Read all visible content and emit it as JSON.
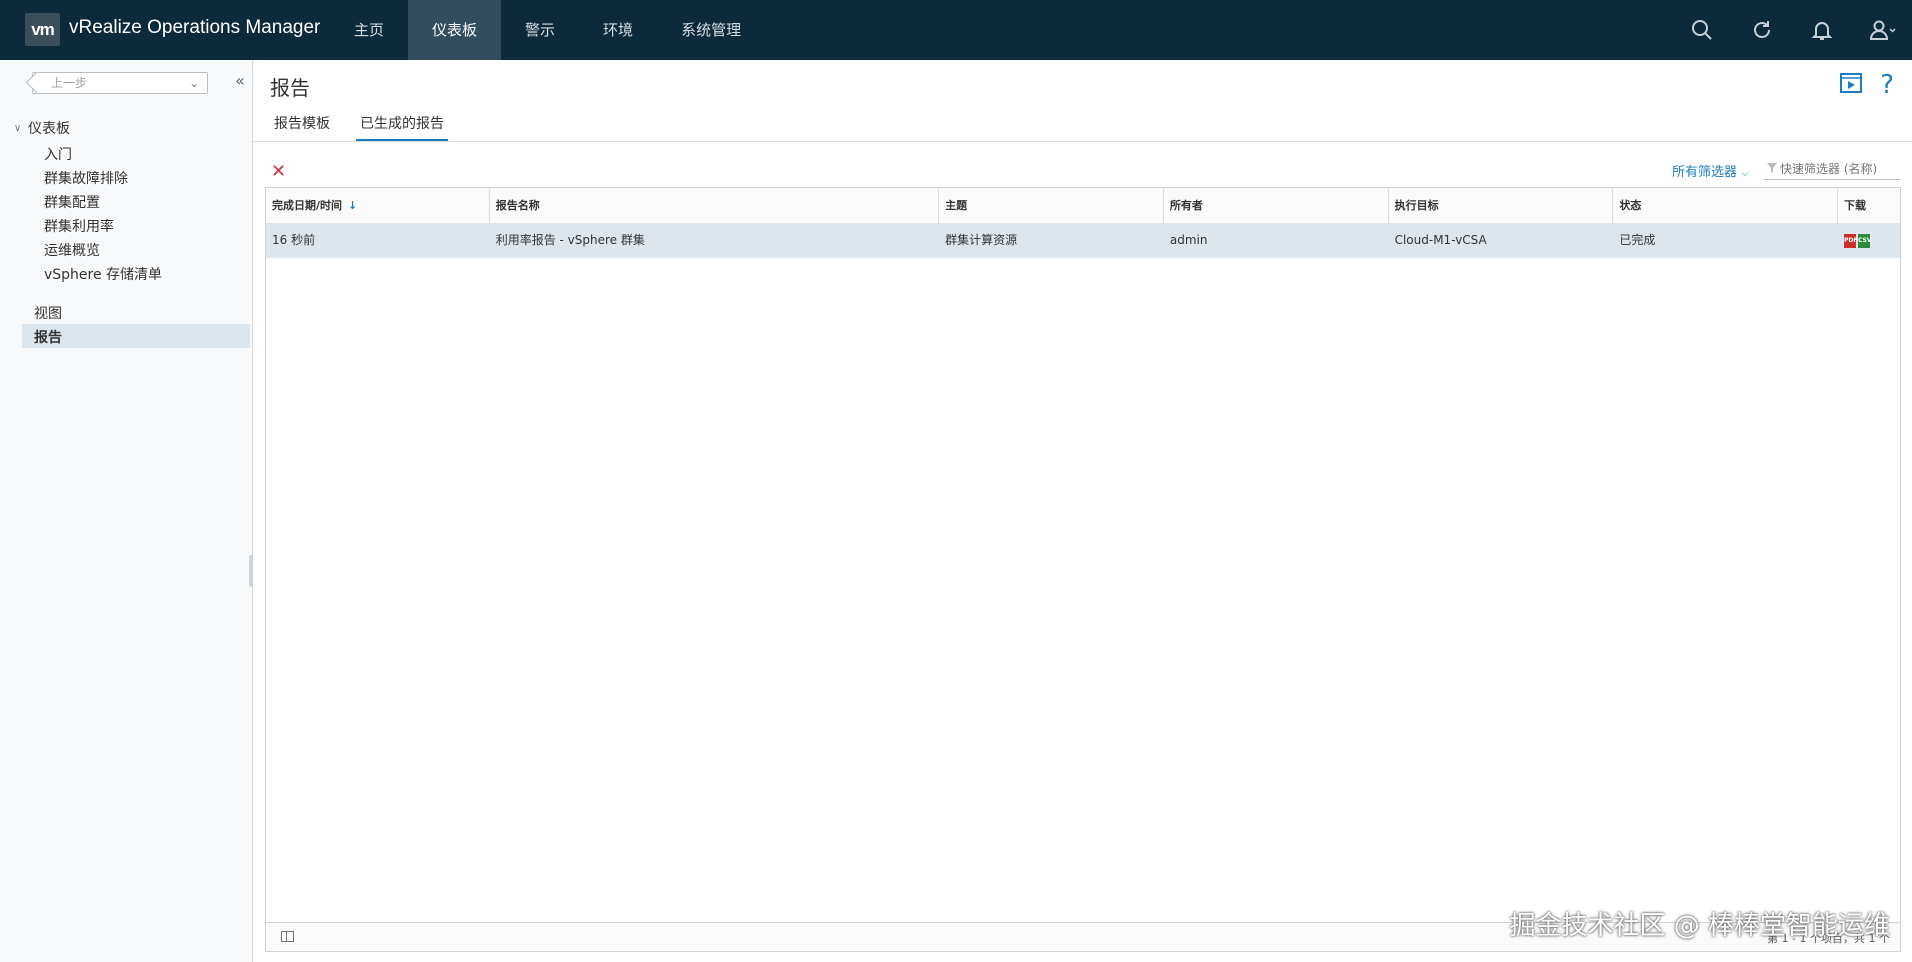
{
  "header": {
    "logo": "vm",
    "app_title": "vRealize Operations Manager",
    "nav": [
      "主页",
      "仪表板",
      "警示",
      "环境",
      "系统管理"
    ],
    "active_nav": 1
  },
  "sidebar": {
    "back_label": "上一步",
    "collapse_glyph": "«",
    "group": "仪表板",
    "group_items": [
      "入门",
      "群集故障排除",
      "群集配置",
      "群集利用率",
      "运维概览",
      "vSphere 存储清单"
    ],
    "links": [
      "视图",
      "报告"
    ],
    "active_link": 1
  },
  "main": {
    "title": "报告",
    "tabs": [
      "报告模板",
      "已生成的报告"
    ],
    "active_tab": 1,
    "filter_label": "所有筛选器",
    "quick_filter_placeholder": "快速筛选器 (名称)"
  },
  "table": {
    "columns": [
      "完成日期/时间",
      "报告名称",
      "主题",
      "所有者",
      "执行目标",
      "状态",
      "下载"
    ],
    "rows": [
      {
        "completed": "16 秒前",
        "name": "利用率报告 - vSphere 群集",
        "subject": "群集计算资源",
        "owner": "admin",
        "target": "Cloud-M1-vCSA",
        "status": "已完成",
        "downloads": [
          "PDF",
          "CSV"
        ]
      }
    ],
    "footer": "第 1 - 1 个项目，共 1 个"
  },
  "watermark": "掘金技术社区 @ 棒棒堂智能运维",
  "colors": {
    "header_bg": "#0d2a3c",
    "nav_active": "#314d5f",
    "accent": "#1b7ec0",
    "delete": "#d0334a",
    "row_selected": "#dde6ec"
  }
}
